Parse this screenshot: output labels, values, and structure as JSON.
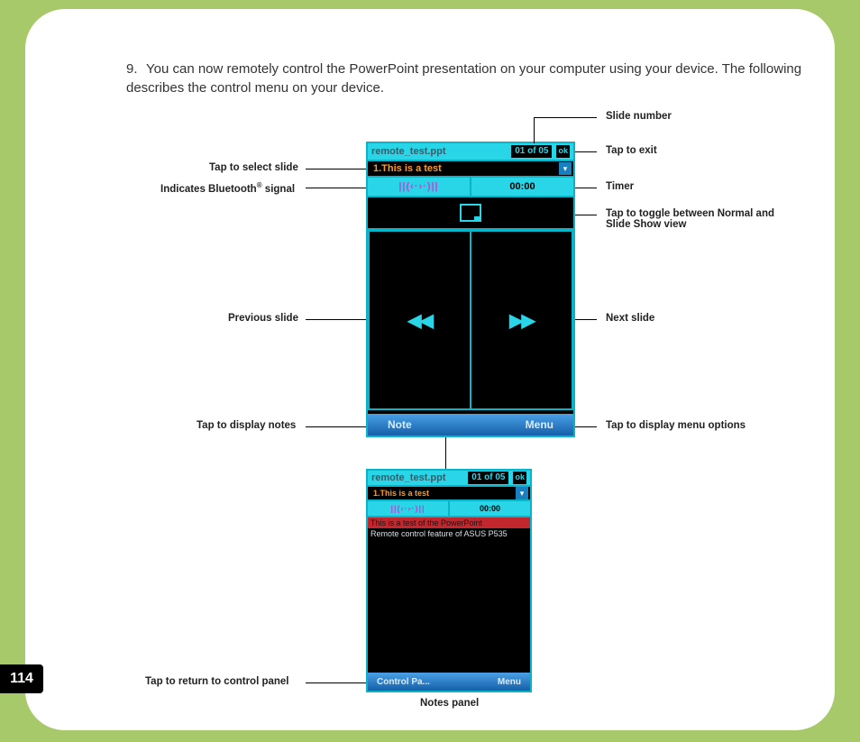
{
  "page": {
    "number": "114",
    "step_number": "9.",
    "body_text": "You can now remotely control the PowerPoint presentation on your computer using your device. The following describes the control menu on your device."
  },
  "labels": {
    "slide_number": "Slide number",
    "tap_exit": "Tap to exit",
    "tap_select_slide": "Tap to select slide",
    "bt_signal_a": "Indicates Bluetooth",
    "bt_signal_b": " signal",
    "timer": "Timer",
    "toggle_view": "Tap to toggle between Normal and Slide Show view",
    "prev_slide": "Previous slide",
    "next_slide": "Next slide",
    "tap_notes": "Tap to display notes",
    "tap_menu": "Tap to display menu options",
    "tap_return": "Tap to return to control panel",
    "notes_panel": "Notes panel"
  },
  "device1": {
    "filename": "remote_test.ppt",
    "slide_count": "01 of 05",
    "ok": "ok",
    "slide_title": "1.This is a test",
    "bt_glyph": "||(‹·›·)||",
    "timer_value": "00:00",
    "soft_left": "Note",
    "soft_right": "Menu"
  },
  "device2": {
    "filename": "remote_test.ppt",
    "slide_count": "01 of 05",
    "ok": "ok",
    "slide_title": "1.This is a test",
    "bt_glyph": "||(‹·›·)||",
    "timer_value": "00:00",
    "note_highlight": "This is a test of the PowerPoint",
    "note_body": "Remote control feature of ASUS P535",
    "soft_left": "Control Pa...",
    "soft_right": "Menu"
  }
}
